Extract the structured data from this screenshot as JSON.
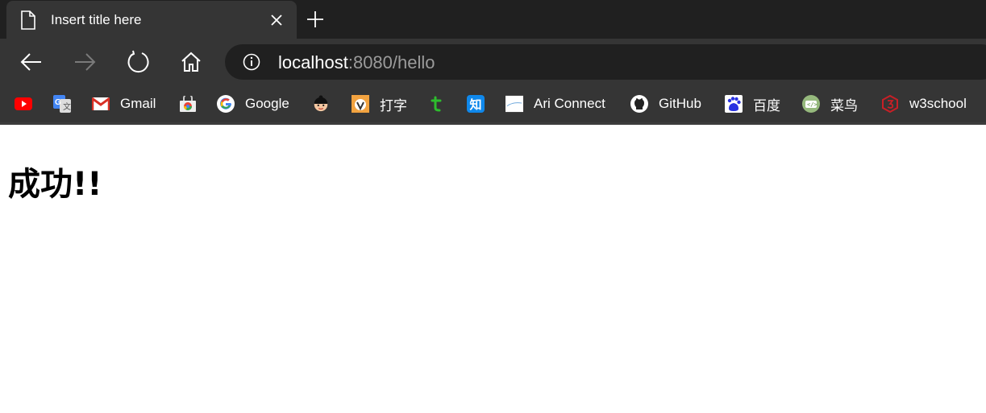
{
  "tab": {
    "title": "Insert title here"
  },
  "address_bar": {
    "host": "localhost",
    "rest": ":8080/hello"
  },
  "bookmarks": [
    {
      "label": "",
      "icon": "youtube-icon"
    },
    {
      "label": "",
      "icon": "google-translate-icon"
    },
    {
      "label": "Gmail",
      "icon": "gmail-icon"
    },
    {
      "label": "",
      "icon": "chrome-web-store-icon"
    },
    {
      "label": "Google",
      "icon": "google-icon"
    },
    {
      "label": "",
      "icon": "avatar-icon"
    },
    {
      "label": "打字",
      "icon": "typing-app-icon"
    },
    {
      "label": "",
      "icon": "t-icon"
    },
    {
      "label": "",
      "icon": "zhihu-icon",
      "glyph": "知"
    },
    {
      "label": "Ari Connect",
      "icon": "ari-connect-icon"
    },
    {
      "label": "GitHub",
      "icon": "github-icon"
    },
    {
      "label": "百度",
      "icon": "baidu-icon"
    },
    {
      "label": "菜鸟",
      "icon": "runoob-icon"
    },
    {
      "label": "w3school",
      "icon": "w3school-icon"
    }
  ],
  "page": {
    "heading": "成功!!"
  },
  "colors": {
    "tabstrip": "#202020",
    "toolbar": "#353535",
    "omnibox": "#202020",
    "url_host": "#ffffff",
    "url_rest": "#9b9b9b"
  }
}
